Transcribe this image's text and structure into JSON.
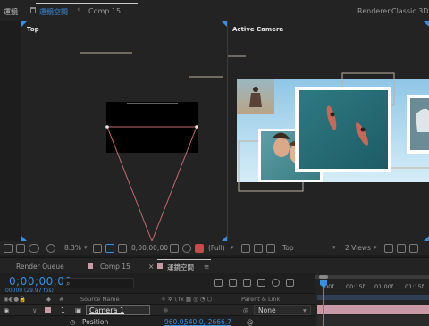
{
  "topbar": {
    "title": "運鏡",
    "active_comp": "運鏡空間",
    "breadcrumb_comp": "Comp 15",
    "renderer_label": "Renderer:",
    "renderer_value": "Classic 3D"
  },
  "viewer": {
    "left_view_label": "Top",
    "right_view_label": "Active Camera"
  },
  "viewer_toolbar": {
    "zoom": "8.3%",
    "timecode": "0;00;00;00",
    "resolution": "(Full)",
    "view_name": "Top",
    "views_count": "2 Views"
  },
  "panel_tabs": {
    "render_queue": "Render Queue",
    "comp15": "Comp 15",
    "active": "運鏡空間"
  },
  "timeline": {
    "timecode": "0;00;00;00",
    "frames": "00000 (29.97 fps)",
    "col_source_name": "Source Name",
    "col_parent_link": "Parent & Link",
    "col_hash": "#",
    "ruler_labels": [
      "00f",
      "00:15f",
      "01:00f",
      "01:15f"
    ],
    "layer": {
      "number": "1",
      "name": "Camera 1",
      "parent": "None"
    },
    "property": {
      "name": "Position",
      "value_x": "960.0,",
      "value_y": "540.0,",
      "value_z": "-2666.7"
    }
  },
  "colors": {
    "accent_blue": "#3a8fe0",
    "layer_label": "#c99aa6",
    "camera_lines": "#c46a72"
  }
}
